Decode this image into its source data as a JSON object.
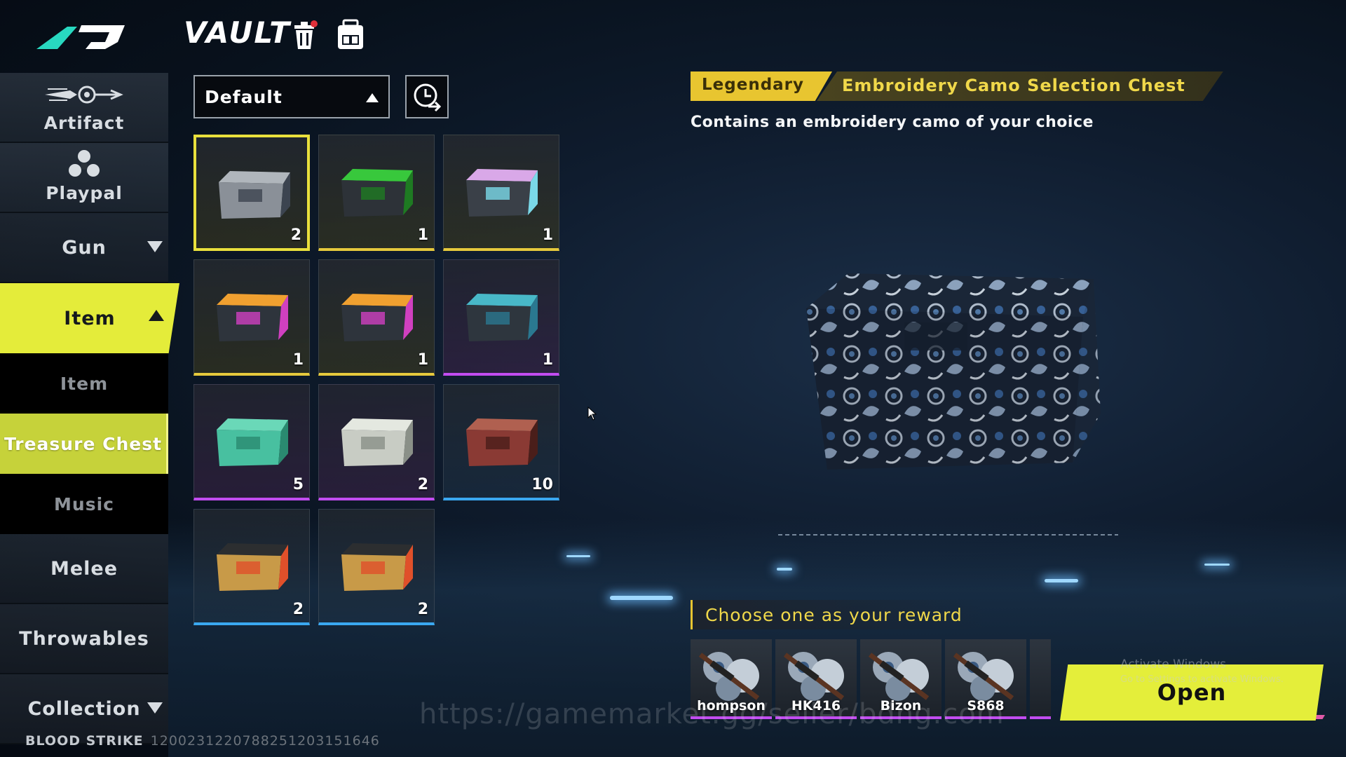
{
  "header": {
    "title": "VAULT",
    "icons": [
      "trash-icon",
      "backpack-icon"
    ]
  },
  "sidebar": {
    "items": [
      {
        "label": "Artifact",
        "icon": "artifact-icon"
      },
      {
        "label": "Playpal",
        "icon": "playpal-icon"
      },
      {
        "label": "Gun"
      },
      {
        "label": "Item",
        "active": true
      },
      {
        "label": "Item"
      },
      {
        "label": "Treasure Chest",
        "active": true
      },
      {
        "label": "Music"
      },
      {
        "label": "Melee"
      },
      {
        "label": "Throwables"
      },
      {
        "label": "Collection"
      }
    ]
  },
  "footer": {
    "game": "BLOOD STRIKE",
    "id": "1200231220788251203151646"
  },
  "filter": {
    "selected": "Default"
  },
  "grid": [
    {
      "count": "2",
      "rarity": "gold",
      "style": "camo",
      "selected": true
    },
    {
      "count": "1",
      "rarity": "gold",
      "style": "green"
    },
    {
      "count": "1",
      "rarity": "gold",
      "style": "pastel"
    },
    {
      "count": "1",
      "rarity": "gold",
      "style": "rainbow"
    },
    {
      "count": "1",
      "rarity": "gold",
      "style": "rainbow"
    },
    {
      "count": "1",
      "rarity": "purple",
      "style": "teal"
    },
    {
      "count": "5",
      "rarity": "purple",
      "style": "mint-crate"
    },
    {
      "count": "2",
      "rarity": "purple",
      "style": "white-crate"
    },
    {
      "count": "10",
      "rarity": "blue",
      "style": "red-camo"
    },
    {
      "count": "2",
      "rarity": "blue",
      "style": "gold-crate"
    },
    {
      "count": "2",
      "rarity": "blue",
      "style": "gold-crate"
    }
  ],
  "detail": {
    "rarity": "Legendary",
    "name": "Embroidery Camo Selection Chest",
    "description": "Contains an embroidery camo of your choice",
    "choose_label": "Choose one as your reward",
    "rewards": [
      {
        "label": "hompson"
      },
      {
        "label": "HK416"
      },
      {
        "label": "Bizon"
      },
      {
        "label": "S868"
      }
    ],
    "open_label": "Open"
  },
  "overlay": {
    "activate_title": "Activate Windows",
    "activate_sub": "Go to Settings to activate Windows.",
    "watermark": "https://gamemarket.gg/seller/bdng.com"
  },
  "colors": {
    "accent_yellow": "#e4ec3a",
    "legendary": "#e8c530",
    "rarity_gold": "#e6c93c",
    "rarity_purple": "#c24cf0",
    "rarity_blue": "#3aa8f0"
  }
}
